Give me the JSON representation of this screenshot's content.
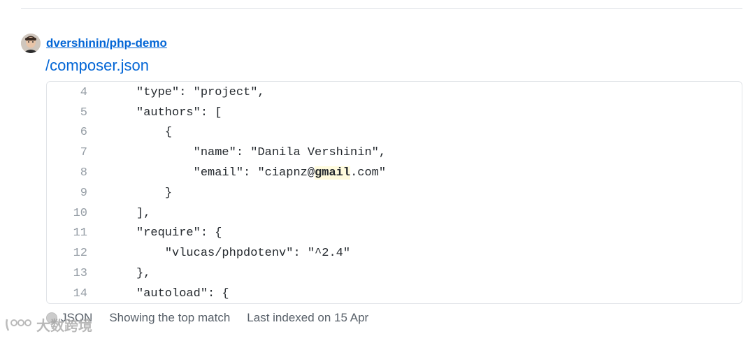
{
  "result": {
    "repo": "dvershinin/php-demo",
    "file_path": "/composer.json",
    "lines": [
      {
        "num": "4",
        "text": "\"type\": \"project\",",
        "indent": 0
      },
      {
        "num": "5",
        "text": "\"authors\": [",
        "indent": 0
      },
      {
        "num": "6",
        "text": "{",
        "indent": 1
      },
      {
        "num": "7",
        "text": "\"name\": \"Danila Vershinin\",",
        "indent": 2
      },
      {
        "num": "8",
        "text_before": "\"email\": \"ciapnz@",
        "highlight": "gmail",
        "text_after": ".com\"",
        "indent": 2
      },
      {
        "num": "9",
        "text": "}",
        "indent": 1
      },
      {
        "num": "10",
        "text": "],",
        "indent": 0
      },
      {
        "num": "11",
        "text": "\"require\": {",
        "indent": 0
      },
      {
        "num": "12",
        "text": "\"vlucas/phpdotenv\": \"^2.4\"",
        "indent": 1
      },
      {
        "num": "13",
        "text": "},",
        "indent": 0
      },
      {
        "num": "14",
        "text": "\"autoload\": {",
        "indent": 0
      }
    ],
    "language": "JSON",
    "language_color": "#cccccc",
    "match_info": "Showing the top match",
    "indexed_info": "Last indexed on 15 Apr"
  },
  "watermark": "大数跨境",
  "colors": {
    "link": "#0366d6",
    "highlight_bg": "#fffbdd",
    "line_number": "#959da5",
    "border": "#e1e4e8"
  }
}
